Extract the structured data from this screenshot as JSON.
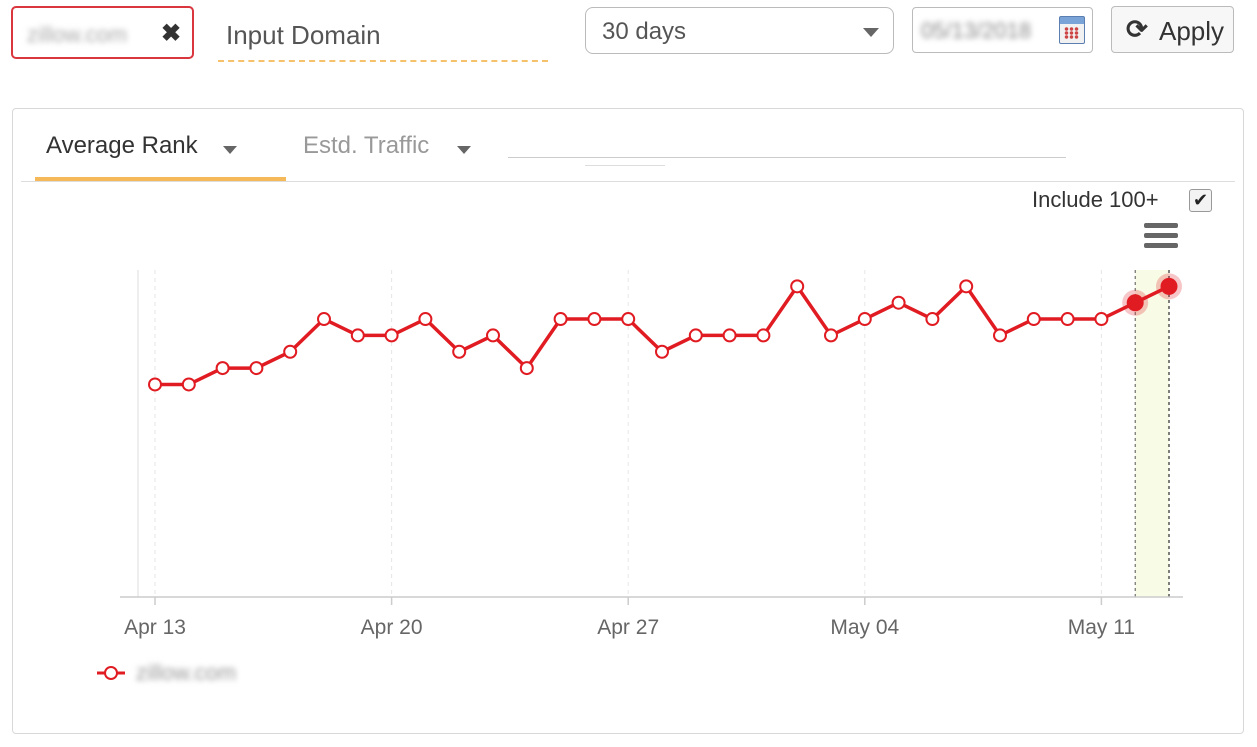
{
  "header": {
    "domain_tag": "zillow.com",
    "domain_input_placeholder": "Input Domain",
    "period_select": "30 days",
    "date_value": "05/13/2018",
    "apply_label": "Apply",
    "apply_icon": "refresh-icon"
  },
  "tabs": [
    {
      "label": "Average Rank",
      "active": true
    },
    {
      "label": "Estd. Traffic",
      "active": false
    }
  ],
  "controls": {
    "include_label": "Include 100+",
    "include_checked": true,
    "menu_icon": "hamburger-menu-icon"
  },
  "colors": {
    "series": "#e11b22",
    "tab_active": "#f6b95a",
    "highlight_band": "#f8fbe6",
    "tag_border": "#d9363e"
  },
  "chart_data": {
    "type": "line",
    "x": [
      "2018-04-13",
      "2018-04-14",
      "2018-04-15",
      "2018-04-16",
      "2018-04-17",
      "2018-04-18",
      "2018-04-19",
      "2018-04-20",
      "2018-04-21",
      "2018-04-22",
      "2018-04-23",
      "2018-04-24",
      "2018-04-25",
      "2018-04-26",
      "2018-04-27",
      "2018-04-28",
      "2018-04-29",
      "2018-04-30",
      "2018-05-01",
      "2018-05-02",
      "2018-05-03",
      "2018-05-04",
      "2018-05-05",
      "2018-05-06",
      "2018-05-07",
      "2018-05-08",
      "2018-05-09",
      "2018-05-10",
      "2018-05-11",
      "2018-05-12",
      "2018-05-13"
    ],
    "x_tick_labels": [
      "Apr 13",
      "Apr 20",
      "Apr 27",
      "May 04",
      "May 11"
    ],
    "x_ticks": [
      "2018-04-13",
      "2018-04-20",
      "2018-04-27",
      "2018-05-04",
      "2018-05-11"
    ],
    "series": [
      {
        "name": "zillow.com",
        "values": [
          7,
          7,
          8,
          8,
          9,
          11,
          10,
          10,
          11,
          9,
          10,
          8,
          11,
          11,
          11,
          9,
          10,
          10,
          10,
          13,
          10,
          11,
          12,
          11,
          13,
          10,
          11,
          11,
          11,
          12,
          13
        ],
        "highlighted": [
          "2018-05-12",
          "2018-05-13"
        ]
      }
    ],
    "highlight_range": [
      "2018-05-12",
      "2018-05-13"
    ],
    "ylim": [
      -6,
      14
    ],
    "grid": "vertical-dashed",
    "legend": "bottom-left",
    "title": "",
    "xlabel": "",
    "ylabel": ""
  }
}
